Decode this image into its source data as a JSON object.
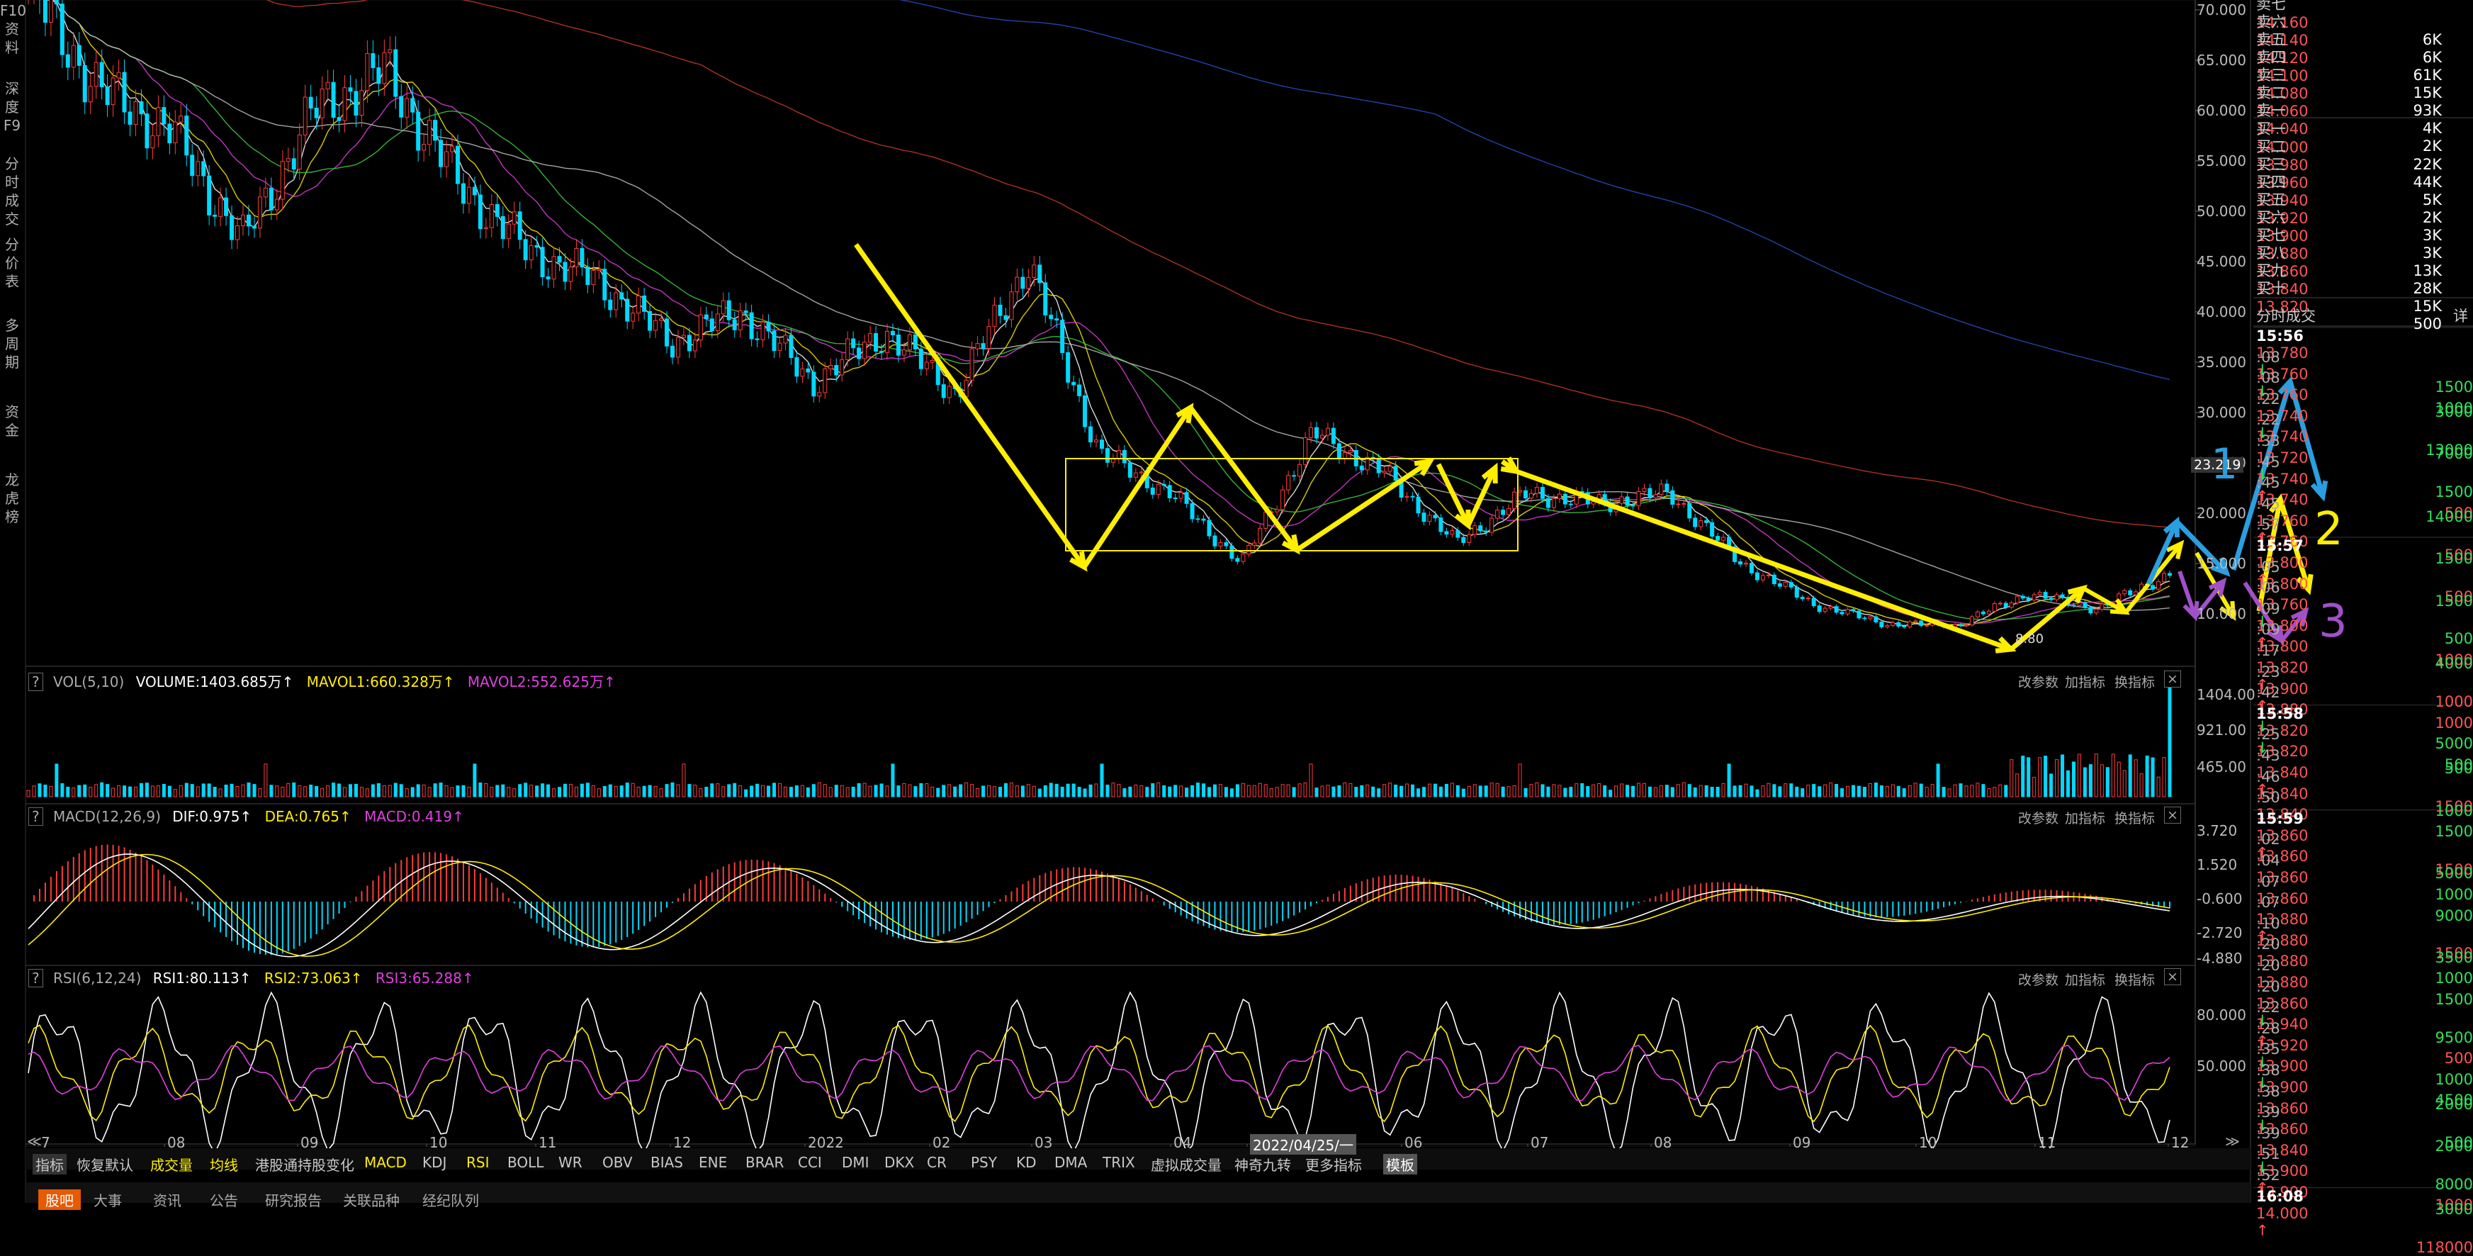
{
  "sidebar": {
    "items": [
      {
        "label": "F10\n资\n料"
      },
      {
        "label": "深\n度\nF9"
      },
      {
        "label": "分\n时\n成\n交"
      },
      {
        "label": "分\n价\n表"
      },
      {
        "label": "多\n周\n期"
      },
      {
        "label": "资\n金"
      },
      {
        "label": "龙\n虎\n榜"
      }
    ]
  },
  "main_chart": {
    "price_axis": [
      "70.000",
      "65.000",
      "60.000",
      "55.000",
      "50.000",
      "45.000",
      "40.000",
      "35.000",
      "30.000",
      "25.000",
      "20.000",
      "15.000",
      "10.000"
    ],
    "current_price_tag": "23.219",
    "low_label": "8.80",
    "month_labels": [
      "7",
      "08",
      "09",
      "10",
      "11",
      "12",
      "2022",
      "02",
      "03",
      "04",
      "2022/04/25/一",
      "06",
      "07",
      "08",
      "09",
      "10",
      "11",
      "12"
    ],
    "annotation_numbers": [
      "1",
      "2",
      "3"
    ],
    "colors": {
      "up": "#ff3b3b",
      "down": "#00d8ff",
      "ma_red": "#c83a2a",
      "ma_blue": "#2a4cc8",
      "annotation_yellow": "#ffee00",
      "annotation_blue": "#2a9fe0",
      "annotation_purple": "#a050c8"
    }
  },
  "vol_panel": {
    "title": "VOL(5,10)",
    "volume": "VOLUME:1403.685万",
    "mavol1": "MAVOL1:660.328万",
    "mavol2": "MAVOL2:552.625万",
    "axis": [
      "1404.00",
      "921.00",
      "465.00"
    ]
  },
  "macd_panel": {
    "title": "MACD(12,26,9)",
    "dif": "DIF:0.975",
    "dea": "DEA:0.765",
    "macd": "MACD:0.419",
    "axis": [
      "3.720",
      "1.520",
      "-0.600",
      "-2.720",
      "-4.880"
    ]
  },
  "rsi_panel": {
    "title": "RSI(6,12,24)",
    "rsi1": "RSI1:80.113",
    "rsi2": "RSI2:73.063",
    "rsi3": "RSI3:65.288",
    "axis": [
      "80.000",
      "50.000"
    ]
  },
  "panel_buttons": [
    "改参数",
    "加指标",
    "换指标"
  ],
  "indicator_tabs": [
    "指标",
    "恢复默认",
    "成交量",
    "均线",
    "港股通持股变化",
    "MACD",
    "KDJ",
    "RSI",
    "BOLL",
    "WR",
    "OBV",
    "BIAS",
    "ENE",
    "BRAR",
    "CCI",
    "DMI",
    "DKX",
    "CR",
    "PSY",
    "KD",
    "DMA",
    "TRIX",
    "虚拟成交量",
    "神奇九转",
    "更多指标",
    "模板"
  ],
  "bottom_tabs": [
    "股吧",
    "大事",
    "资讯",
    "公告",
    "研究报告",
    "关联品种",
    "经纪队列"
  ],
  "order_book": {
    "asks": [
      {
        "label": "卖七",
        "price": "14.160",
        "vol": "6K"
      },
      {
        "label": "卖六",
        "price": "14.140",
        "vol": "6K"
      },
      {
        "label": "卖五",
        "price": "14.120",
        "vol": "61K"
      },
      {
        "label": "卖四",
        "price": "14.100",
        "vol": "15K"
      },
      {
        "label": "卖三",
        "price": "14.080",
        "vol": "93K"
      },
      {
        "label": "卖二",
        "price": "14.060",
        "vol": "4K"
      },
      {
        "label": "卖一",
        "price": "14.040",
        "vol": "2K"
      }
    ],
    "bids": [
      {
        "label": "买一",
        "price": "14.000",
        "vol": "22K"
      },
      {
        "label": "买二",
        "price": "13.980",
        "vol": "44K"
      },
      {
        "label": "买三",
        "price": "13.960",
        "vol": "5K"
      },
      {
        "label": "买四",
        "price": "13.940",
        "vol": "2K"
      },
      {
        "label": "买五",
        "price": "13.920",
        "vol": "3K"
      },
      {
        "label": "买六",
        "price": "13.900",
        "vol": "3K"
      },
      {
        "label": "买七",
        "price": "13.880",
        "vol": "13K"
      },
      {
        "label": "买八",
        "price": "13.860",
        "vol": "28K"
      },
      {
        "label": "买九",
        "price": "13.840",
        "vol": "15K"
      },
      {
        "label": "买十",
        "price": "13.820",
        "vol": "500"
      }
    ]
  },
  "trades": {
    "header": "分时成交",
    "detail_btn": "详",
    "rows": [
      {
        "t": "15:56",
        "p": "13.780",
        "a": "down",
        "v": "1500",
        "big": true
      },
      {
        "t": ":08",
        "p": "13.760",
        "a": "down",
        "v": "1000"
      },
      {
        "t": ":08",
        "p": "13.760",
        "a": "",
        "v": "3000"
      },
      {
        "t": ":22",
        "p": "13.740",
        "a": "down",
        "v": "13000"
      },
      {
        "t": ":22",
        "p": "13.740",
        "a": "",
        "v": "7000"
      },
      {
        "t": ":33",
        "p": "13.720",
        "a": "down",
        "v": "1500"
      },
      {
        "t": ":45",
        "p": "13.740",
        "a": "up",
        "v": "500"
      },
      {
        "t": ":45",
        "p": "13.740",
        "a": "",
        "v": "14000"
      },
      {
        "t": ":45",
        "p": "13.760",
        "a": "up",
        "v": "500"
      },
      {
        "t": ":57",
        "p": "13.760",
        "a": "",
        "v": "1500"
      },
      {
        "t": "15:57",
        "p": "13.800",
        "a": "up",
        "v": "500",
        "big": true
      },
      {
        "t": ":05",
        "p": "13.800",
        "a": "",
        "v": "1500"
      },
      {
        "t": ":06",
        "p": "13.760",
        "a": "down",
        "v": "500"
      },
      {
        "t": ":09",
        "p": "13.800",
        "a": "up",
        "v": "1000"
      },
      {
        "t": ":09",
        "p": "13.800",
        "a": "",
        "v": "4000"
      },
      {
        "t": ":17",
        "p": "13.820",
        "a": "up",
        "v": "1000"
      },
      {
        "t": ":23",
        "p": "13.900",
        "a": "up",
        "v": "1000"
      },
      {
        "t": ":42",
        "p": "13.880",
        "a": "down",
        "v": "5000"
      },
      {
        "t": "15:58",
        "p": "13.820",
        "a": "down",
        "v": "500",
        "big": true
      },
      {
        "t": ":25",
        "p": "13.820",
        "a": "",
        "v": "500"
      },
      {
        "t": ":43",
        "p": "13.840",
        "a": "up",
        "v": "1500"
      },
      {
        "t": ":46",
        "p": "13.840",
        "a": "",
        "v": "1000"
      },
      {
        "t": ":50",
        "p": "13.840",
        "a": "",
        "v": "1500"
      },
      {
        "t": "15:59",
        "p": "13.860",
        "a": "up",
        "v": "1500",
        "big": true
      },
      {
        "t": ":02",
        "p": "13.860",
        "a": "",
        "v": "5000"
      },
      {
        "t": ":04",
        "p": "13.860",
        "a": "",
        "v": "1000"
      },
      {
        "t": ":07",
        "p": "13.860",
        "a": "",
        "v": "9000"
      },
      {
        "t": ":07",
        "p": "13.880",
        "a": "up",
        "v": "1500"
      },
      {
        "t": ":10",
        "p": "13.880",
        "a": "",
        "v": "3500"
      },
      {
        "t": ":20",
        "p": "13.880",
        "a": "",
        "v": "1000"
      },
      {
        "t": ":20",
        "p": "13.880",
        "a": "",
        "v": "1500"
      },
      {
        "t": ":20",
        "p": "13.860",
        "a": "down",
        "v": "9500"
      },
      {
        "t": ":22",
        "p": "13.940",
        "a": "up",
        "v": "500"
      },
      {
        "t": ":28",
        "p": "13.920",
        "a": "down",
        "v": "1000"
      },
      {
        "t": ":35",
        "p": "13.900",
        "a": "down",
        "v": "4500"
      },
      {
        "t": ":38",
        "p": "13.900",
        "a": "",
        "v": "2000"
      },
      {
        "t": ":38",
        "p": "13.860",
        "a": "down",
        "v": "500"
      },
      {
        "t": ":39",
        "p": "13.860",
        "a": "",
        "v": "2000"
      },
      {
        "t": ":39",
        "p": "13.840",
        "a": "down",
        "v": "8000"
      },
      {
        "t": ":51",
        "p": "13.900",
        "a": "up",
        "v": "1000"
      },
      {
        "t": ":52",
        "p": "13.900",
        "a": "",
        "v": "3000"
      },
      {
        "t": "16:08",
        "p": "14.000",
        "a": "up",
        "v": "118000",
        "big": true
      }
    ]
  },
  "chart_data": {
    "type": "candlestick",
    "x_range": [
      "2021-07",
      "2022-12"
    ],
    "ylim": [
      8,
      70
    ],
    "close_path": [
      {
        "x": "2021-07",
        "y": 72
      },
      {
        "x": "2021-08",
        "y": 62
      },
      {
        "x": "2021-08b",
        "y": 58
      },
      {
        "x": "2021-09",
        "y": 47
      },
      {
        "x": "2021-09b",
        "y": 60
      },
      {
        "x": "2021-09c",
        "y": 64
      },
      {
        "x": "2021-10",
        "y": 53
      },
      {
        "x": "2021-10b",
        "y": 46
      },
      {
        "x": "2021-11",
        "y": 43
      },
      {
        "x": "2021-11b",
        "y": 37
      },
      {
        "x": "2021-12",
        "y": 40
      },
      {
        "x": "2021-12b",
        "y": 33
      },
      {
        "x": "2022-01",
        "y": 38
      },
      {
        "x": "2022-01b",
        "y": 32
      },
      {
        "x": "2022-01c",
        "y": 45
      },
      {
        "x": "2022-02",
        "y": 26
      },
      {
        "x": "2022-03",
        "y": 22
      },
      {
        "x": "2022-03b",
        "y": 15
      },
      {
        "x": "2022-04",
        "y": 28
      },
      {
        "x": "2022-04b",
        "y": 24
      },
      {
        "x": "2022-05",
        "y": 17
      },
      {
        "x": "2022-06",
        "y": 22
      },
      {
        "x": "2022-06b",
        "y": 21
      },
      {
        "x": "2022-07",
        "y": 22
      },
      {
        "x": "2022-08",
        "y": 15
      },
      {
        "x": "2022-09",
        "y": 11
      },
      {
        "x": "2022-10",
        "y": 9
      },
      {
        "x": "2022-10b",
        "y": 8.8
      },
      {
        "x": "2022-11",
        "y": 12
      },
      {
        "x": "2022-11b",
        "y": 10.5
      },
      {
        "x": "2022-12",
        "y": 14
      }
    ]
  }
}
